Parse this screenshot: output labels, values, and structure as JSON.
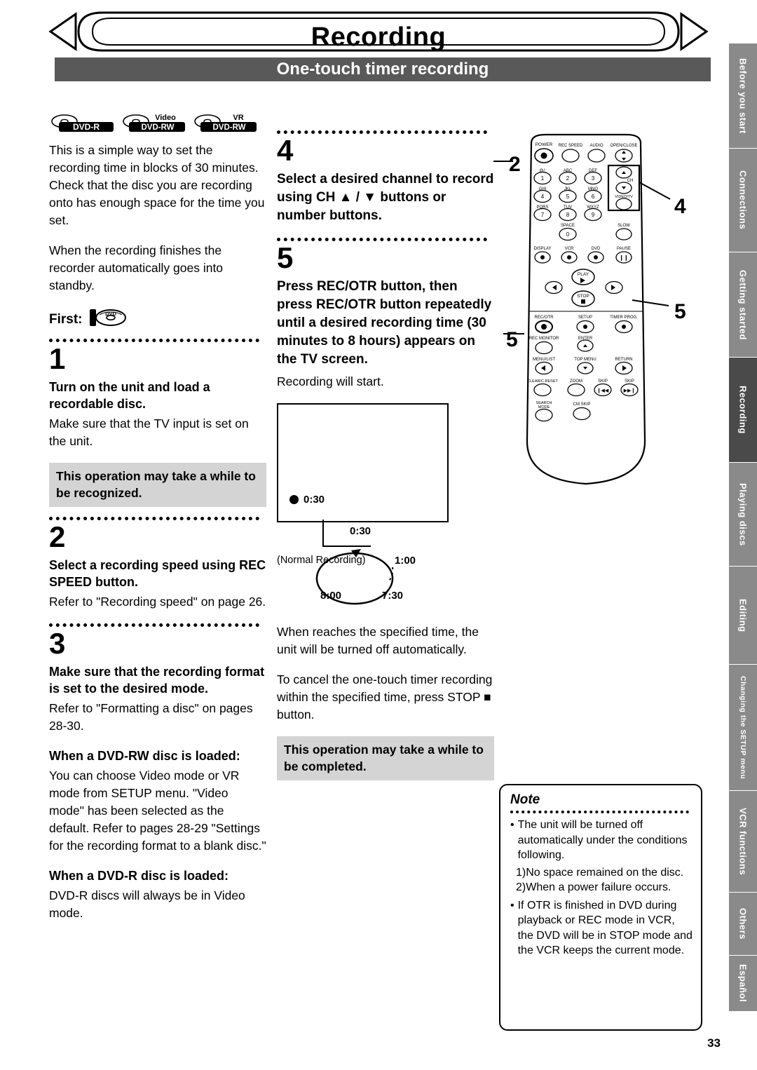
{
  "header": {
    "title": "Recording",
    "subtitle": "One-touch timer recording"
  },
  "side_tabs": [
    {
      "label": "Before you start",
      "active": false
    },
    {
      "label": "Connections",
      "active": false
    },
    {
      "label": "Getting started",
      "active": false
    },
    {
      "label": "Recording",
      "active": true
    },
    {
      "label": "Playing discs",
      "active": false
    },
    {
      "label": "Editing",
      "active": false
    },
    {
      "label": "Changing the SETUP menu",
      "active": false
    },
    {
      "label": "VCR functions",
      "active": false
    },
    {
      "label": "Others",
      "active": false
    },
    {
      "label": "Español",
      "active": false
    }
  ],
  "disc_logos": [
    {
      "name": "DVD-R",
      "top": ""
    },
    {
      "name": "DVD-RW",
      "top": "Video"
    },
    {
      "name": "DVD-RW",
      "top": "VR"
    }
  ],
  "left": {
    "intro1": "This is a simple way to set the recording time in blocks of 30 minutes. Check that the disc you are recording onto has enough space for the time you set.",
    "intro2": "When the recording finishes the recorder automatically goes into standby.",
    "first_label": "First:",
    "step1_num": "1",
    "step1_head": "Turn on the unit and load a recordable disc.",
    "step1_body": "Make sure that the TV input is set on the unit.",
    "step1_note": "This operation may take a while to be recognized.",
    "step2_num": "2",
    "step2_head": "Select a recording speed using REC SPEED button.",
    "step2_body": "Refer to \"Recording speed\" on page 26.",
    "step3_num": "3",
    "step3_head": "Make sure that the recording format is set to the desired mode.",
    "step3_body": "Refer to \"Formatting a disc\" on pages 28-30.",
    "step3_sub1_head": "When a DVD-RW disc is loaded:",
    "step3_sub1_body": "You can choose Video mode or VR mode from SETUP menu. \"Video mode\" has been selected as the default. Refer to pages 28-29 \"Settings for the recording format to a blank disc.\"",
    "step3_sub2_head": "When a DVD-R disc is loaded:",
    "step3_sub2_body": "DVD-R discs will always be in Video mode."
  },
  "mid": {
    "step4_num": "4",
    "step4_head": "Select a desired channel to record using CH ▲ / ▼ buttons or number buttons.",
    "step5_num": "5",
    "step5_head": "Press REC/OTR button, then press REC/OTR button repeatedly until a desired recording time (30 minutes to 8 hours) appears on the TV screen.",
    "step5_body": "Recording will start.",
    "tv_rec_time": "0:30",
    "cycle": {
      "top": "0:30",
      "left": "(Normal Recording)",
      "right": "1:00",
      "bottom_left": "8:00",
      "bottom_right": "7:30"
    },
    "after1": "When reaches the specified time, the unit will be turned off automatically.",
    "after2": "To cancel the one-touch timer recording within the specified time, press STOP ■ button.",
    "gray_note": "This operation may take a while to be completed."
  },
  "note": {
    "title": "Note",
    "items": [
      {
        "bullet": "•",
        "text": "The unit will be turned off automatically under the conditions following."
      },
      {
        "bullet": "",
        "text": "1)No space remained on the disc."
      },
      {
        "bullet": "",
        "text": "2)When a power failure occurs."
      },
      {
        "bullet": "•",
        "text": "If OTR is finished in DVD during playback or REC mode in VCR, the DVD will be in STOP mode and the VCR keeps the current mode."
      }
    ]
  },
  "remote": {
    "callouts": [
      "2",
      "4",
      "5",
      "5"
    ],
    "buttons": [
      "POWER",
      "REC SPEED",
      "AUDIO",
      "OPEN/CLOSE",
      "@/:",
      "ABC",
      "DEF",
      "1",
      "2",
      "3",
      "GHI",
      "JKL",
      "MNO",
      "4",
      "5",
      "6",
      "CH",
      "PQRS",
      "TUV",
      "WXYZ",
      "7",
      "8",
      "9",
      "VIDEO/TV",
      "SPACE",
      "0",
      "SLOW",
      "DISPLAY",
      "VCR",
      "DVD",
      "PAUSE",
      "PLAY",
      "STOP",
      "REC/OTR",
      "SETUP",
      "TIMER PROG.",
      "REC MONITOR",
      "ENTER",
      "MENU/LIST",
      "TOP MENU",
      "RETURN",
      "CLEAR/C.RESET",
      "ZOOM",
      "SKIP",
      "SKIP",
      "SEARCH MODE",
      "CM SKIP"
    ]
  },
  "page_number": "33"
}
